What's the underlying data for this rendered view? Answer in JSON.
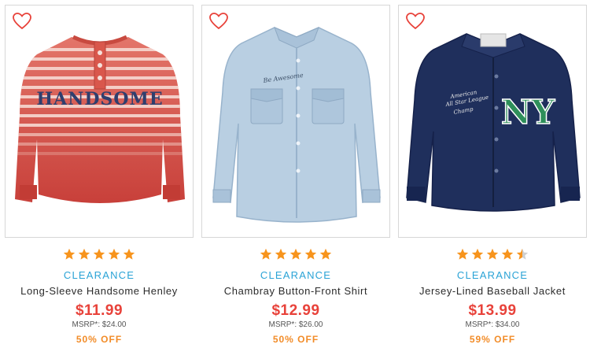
{
  "colors": {
    "star": "#f7941d",
    "star_empty": "#cfcfcf",
    "clearance": "#2aa3d6",
    "price": "#e8423a",
    "discount": "#f28c28",
    "heart": "#e8423a"
  },
  "products": [
    {
      "badge": "CLEARANCE",
      "name": "Long-Sleeve Handsome Henley",
      "price": "$11.99",
      "msrp": "MSRP*: $24.00",
      "discount": "50% OFF",
      "rating": 5,
      "favorite_icon": "heart-outline-icon",
      "shirt_text": "HANDSOME"
    },
    {
      "badge": "CLEARANCE",
      "name": "Chambray Button-Front Shirt",
      "price": "$12.99",
      "msrp": "MSRP*: $26.00",
      "discount": "50% OFF",
      "rating": 5,
      "favorite_icon": "heart-outline-icon",
      "shirt_text": "Be Awesome"
    },
    {
      "badge": "CLEARANCE",
      "name": "Jersey-Lined Baseball Jacket",
      "price": "$13.99",
      "msrp": "MSRP*: $34.00",
      "discount": "59% OFF",
      "rating": 4.5,
      "favorite_icon": "heart-outline-icon",
      "shirt_text": "NY"
    }
  ]
}
